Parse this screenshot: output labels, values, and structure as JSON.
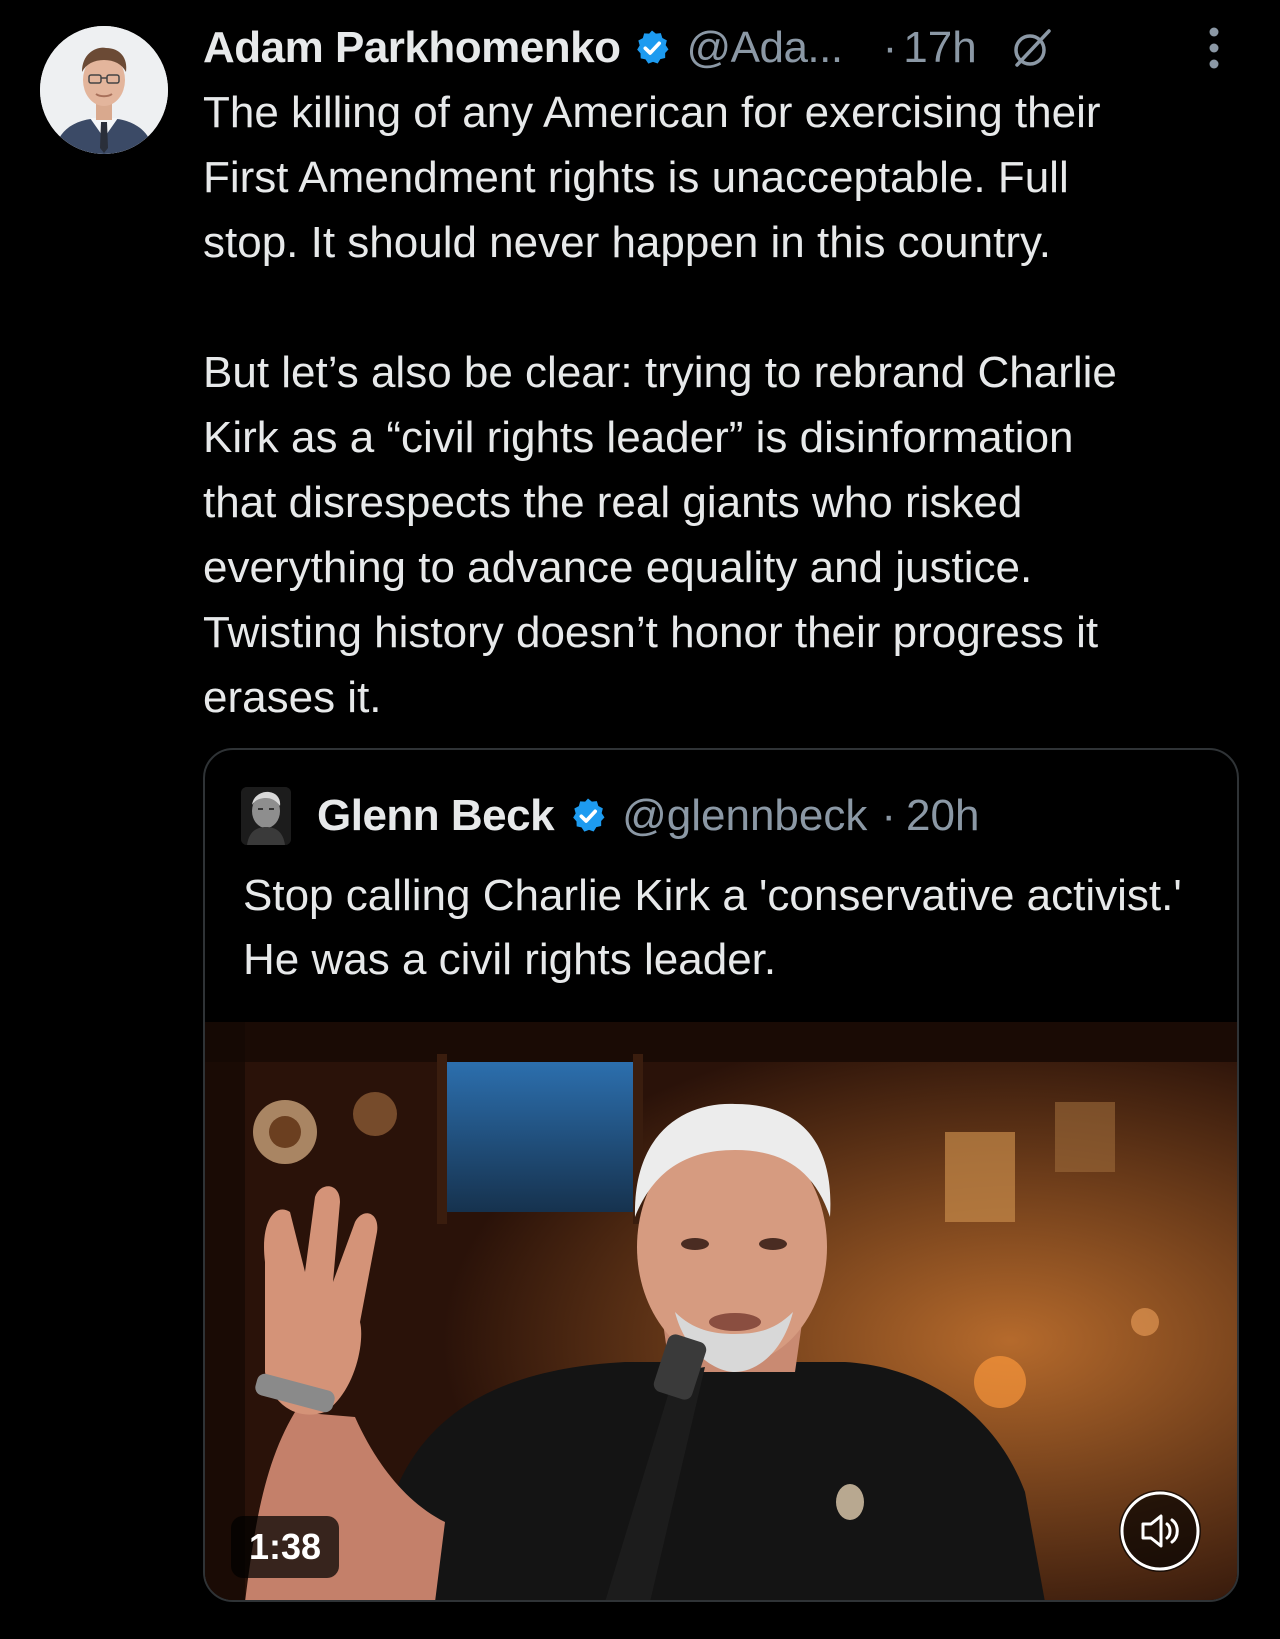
{
  "tweet": {
    "author_name": "Adam Parkhomenko",
    "handle": "@Ada...",
    "separator": "·",
    "time": "17h",
    "text": "The killing of any American for exercising their\nFirst Amendment rights is unacceptable. Full\nstop. It should never happen in this country.\n\nBut let’s also be clear: trying to rebrand Charlie\nKirk as a “civil rights leader” is disinformation\nthat disrespects the real giants who risked\neverything to advance equality and justice.\nTwisting history doesn’t honor their progress it\nerases it."
  },
  "quote": {
    "author_name": "Glenn Beck",
    "handle": "@glennbeck",
    "separator": "·",
    "time": "20h",
    "text": "Stop calling Charlie Kirk a 'conservative activist.' He was a civil rights leader.",
    "video": {
      "duration": "1:38"
    }
  },
  "icons": {
    "verified": "verified-badge-icon",
    "grok": "grok-slash-icon",
    "more": "more-vertical-icon",
    "mute": "speaker-muted-icon"
  },
  "colors": {
    "background": "#000000",
    "text": "#e7e9ea",
    "secondary": "#8b98a5",
    "verified": "#1d9bf0",
    "border": "#2f3336"
  }
}
